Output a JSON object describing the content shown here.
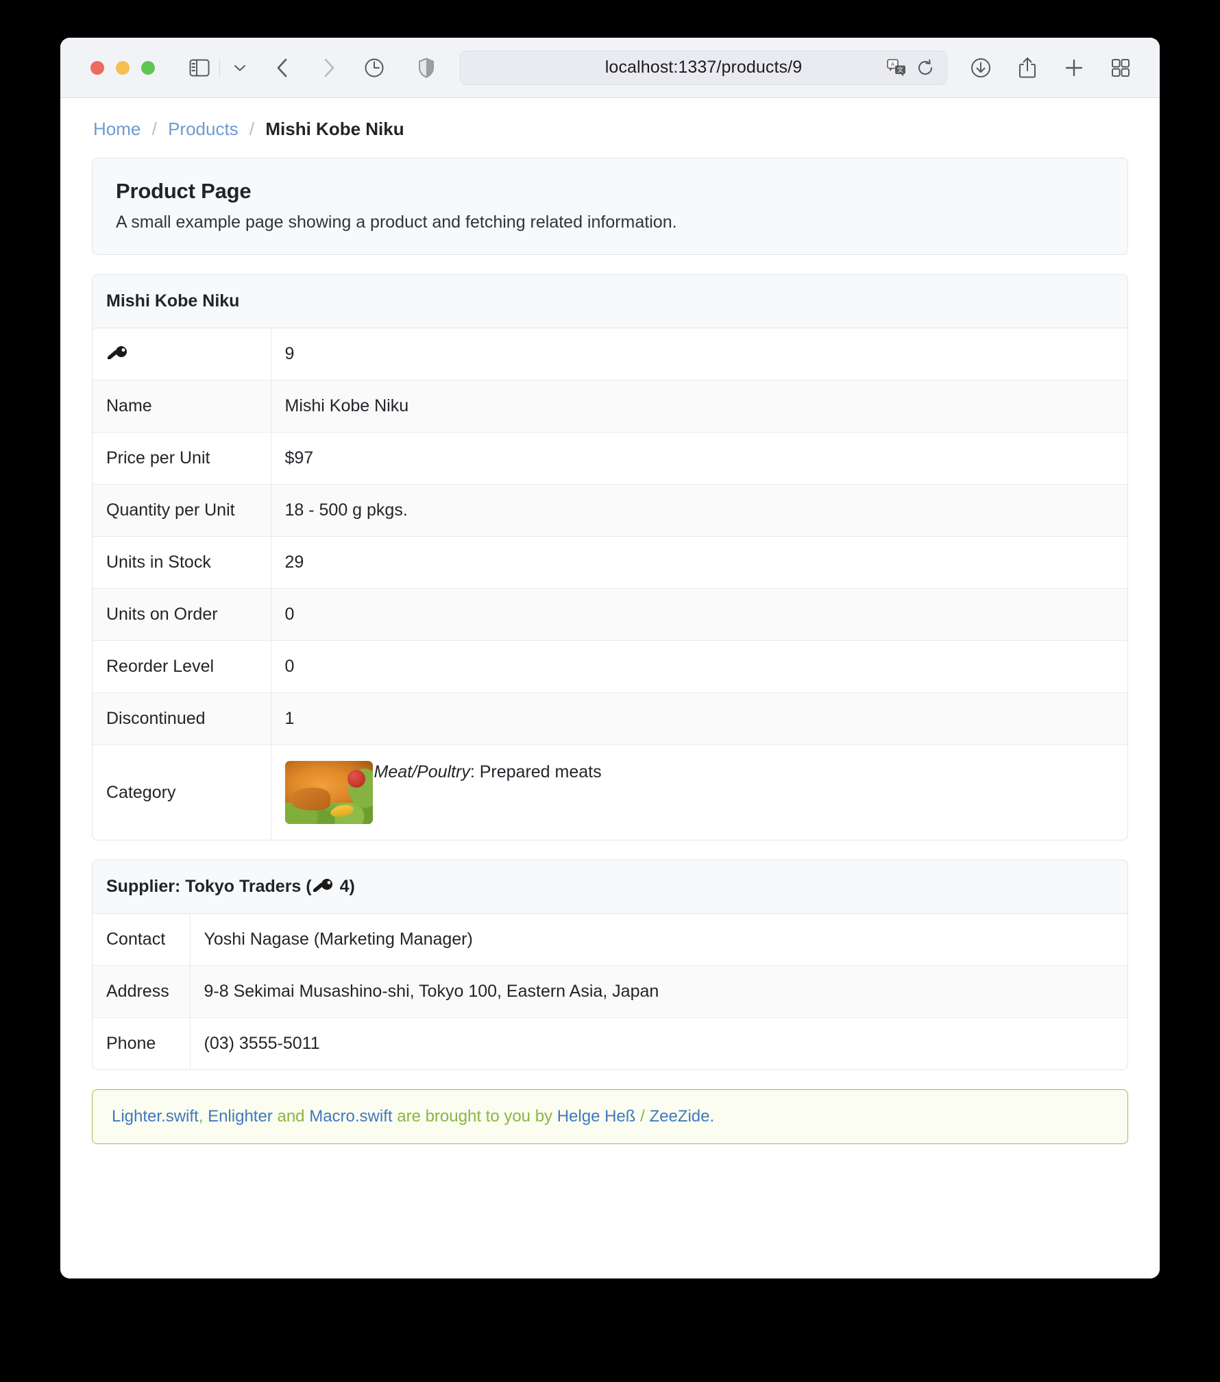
{
  "browser": {
    "url": "localhost:1337/products/9",
    "toolbar_icons": [
      "sidebar-icon",
      "chevron-down-icon",
      "back-icon",
      "forward-icon",
      "history-clock-icon",
      "shield-icon",
      "translate-icon",
      "reload-icon",
      "downloads-icon",
      "share-icon",
      "new-tab-icon",
      "tab-overview-icon"
    ]
  },
  "breadcrumb": {
    "home": "Home",
    "products": "Products",
    "separator": "/",
    "current": "Mishi Kobe Niku"
  },
  "jumbotron": {
    "title": "Product Page",
    "subtitle": "A small example page showing a product and fetching related information."
  },
  "product_card": {
    "header": "Mishi Kobe Niku",
    "rows": [
      {
        "label": "\u0000key-icon",
        "is_key": true,
        "value": "9"
      },
      {
        "label": "Name",
        "value": "Mishi Kobe Niku"
      },
      {
        "label": "Price per Unit",
        "value": "$97"
      },
      {
        "label": "Quantity per Unit",
        "value": "18 - 500 g pkgs."
      },
      {
        "label": "Units in Stock",
        "value": "29"
      },
      {
        "label": "Units on Order",
        "value": "0"
      },
      {
        "label": "Reorder Level",
        "value": "0"
      },
      {
        "label": "Discontinued",
        "value": "1"
      }
    ],
    "category": {
      "label": "Category",
      "image_name": "meat-poultry-category-image",
      "name": "Meat/Poultry",
      "description": ": Prepared meats"
    }
  },
  "supplier_card": {
    "header_prefix": "Supplier: Tokyo Traders (",
    "header_key_icon": "key-icon",
    "header_id": "4",
    "header_suffix": ")",
    "rows": [
      {
        "label": "Contact",
        "value": "Yoshi Nagase (Marketing Manager)"
      },
      {
        "label": "Address",
        "value": "9-8 Sekimai Musashino-shi, Tokyo 100, Eastern Asia, Japan"
      },
      {
        "label": "Phone",
        "value": "(03) 3555-5011"
      }
    ]
  },
  "footer": {
    "link1": "Lighter.swift",
    "comma": ", ",
    "link2": "Enlighter",
    "text1": " and ",
    "link3": "Macro.swift",
    "text2": " are brought to you by ",
    "link4": "Helge Heß",
    "text3": " / ",
    "link5": "ZeeZide.",
    "colors": {
      "link": "#4178be",
      "text": "#8ab545",
      "border": "#96bf4e",
      "background": "#fbfdf0"
    }
  }
}
